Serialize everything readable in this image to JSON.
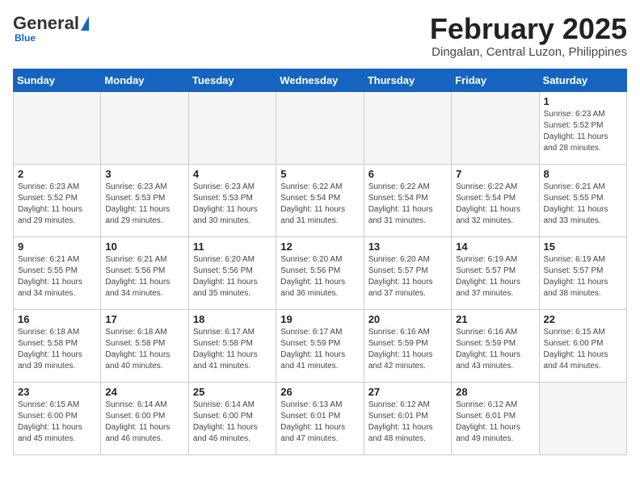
{
  "header": {
    "logo_general": "General",
    "logo_blue": "Blue",
    "title": "February 2025",
    "subtitle": "Dingalan, Central Luzon, Philippines"
  },
  "weekdays": [
    "Sunday",
    "Monday",
    "Tuesday",
    "Wednesday",
    "Thursday",
    "Friday",
    "Saturday"
  ],
  "weeks": [
    [
      {
        "day": "",
        "info": ""
      },
      {
        "day": "",
        "info": ""
      },
      {
        "day": "",
        "info": ""
      },
      {
        "day": "",
        "info": ""
      },
      {
        "day": "",
        "info": ""
      },
      {
        "day": "",
        "info": ""
      },
      {
        "day": "1",
        "info": "Sunrise: 6:23 AM\nSunset: 5:52 PM\nDaylight: 11 hours and 28 minutes."
      }
    ],
    [
      {
        "day": "2",
        "info": "Sunrise: 6:23 AM\nSunset: 5:52 PM\nDaylight: 11 hours and 29 minutes."
      },
      {
        "day": "3",
        "info": "Sunrise: 6:23 AM\nSunset: 5:53 PM\nDaylight: 11 hours and 29 minutes."
      },
      {
        "day": "4",
        "info": "Sunrise: 6:23 AM\nSunset: 5:53 PM\nDaylight: 11 hours and 30 minutes."
      },
      {
        "day": "5",
        "info": "Sunrise: 6:22 AM\nSunset: 5:54 PM\nDaylight: 11 hours and 31 minutes."
      },
      {
        "day": "6",
        "info": "Sunrise: 6:22 AM\nSunset: 5:54 PM\nDaylight: 11 hours and 31 minutes."
      },
      {
        "day": "7",
        "info": "Sunrise: 6:22 AM\nSunset: 5:54 PM\nDaylight: 11 hours and 32 minutes."
      },
      {
        "day": "8",
        "info": "Sunrise: 6:21 AM\nSunset: 5:55 PM\nDaylight: 11 hours and 33 minutes."
      }
    ],
    [
      {
        "day": "9",
        "info": "Sunrise: 6:21 AM\nSunset: 5:55 PM\nDaylight: 11 hours and 34 minutes."
      },
      {
        "day": "10",
        "info": "Sunrise: 6:21 AM\nSunset: 5:56 PM\nDaylight: 11 hours and 34 minutes."
      },
      {
        "day": "11",
        "info": "Sunrise: 6:20 AM\nSunset: 5:56 PM\nDaylight: 11 hours and 35 minutes."
      },
      {
        "day": "12",
        "info": "Sunrise: 6:20 AM\nSunset: 5:56 PM\nDaylight: 11 hours and 36 minutes."
      },
      {
        "day": "13",
        "info": "Sunrise: 6:20 AM\nSunset: 5:57 PM\nDaylight: 11 hours and 37 minutes."
      },
      {
        "day": "14",
        "info": "Sunrise: 6:19 AM\nSunset: 5:57 PM\nDaylight: 11 hours and 37 minutes."
      },
      {
        "day": "15",
        "info": "Sunrise: 6:19 AM\nSunset: 5:57 PM\nDaylight: 11 hours and 38 minutes."
      }
    ],
    [
      {
        "day": "16",
        "info": "Sunrise: 6:18 AM\nSunset: 5:58 PM\nDaylight: 11 hours and 39 minutes."
      },
      {
        "day": "17",
        "info": "Sunrise: 6:18 AM\nSunset: 5:58 PM\nDaylight: 11 hours and 40 minutes."
      },
      {
        "day": "18",
        "info": "Sunrise: 6:17 AM\nSunset: 5:58 PM\nDaylight: 11 hours and 41 minutes."
      },
      {
        "day": "19",
        "info": "Sunrise: 6:17 AM\nSunset: 5:59 PM\nDaylight: 11 hours and 41 minutes."
      },
      {
        "day": "20",
        "info": "Sunrise: 6:16 AM\nSunset: 5:59 PM\nDaylight: 11 hours and 42 minutes."
      },
      {
        "day": "21",
        "info": "Sunrise: 6:16 AM\nSunset: 5:59 PM\nDaylight: 11 hours and 43 minutes."
      },
      {
        "day": "22",
        "info": "Sunrise: 6:15 AM\nSunset: 6:00 PM\nDaylight: 11 hours and 44 minutes."
      }
    ],
    [
      {
        "day": "23",
        "info": "Sunrise: 6:15 AM\nSunset: 6:00 PM\nDaylight: 11 hours and 45 minutes."
      },
      {
        "day": "24",
        "info": "Sunrise: 6:14 AM\nSunset: 6:00 PM\nDaylight: 11 hours and 46 minutes."
      },
      {
        "day": "25",
        "info": "Sunrise: 6:14 AM\nSunset: 6:00 PM\nDaylight: 11 hours and 46 minutes."
      },
      {
        "day": "26",
        "info": "Sunrise: 6:13 AM\nSunset: 6:01 PM\nDaylight: 11 hours and 47 minutes."
      },
      {
        "day": "27",
        "info": "Sunrise: 6:12 AM\nSunset: 6:01 PM\nDaylight: 11 hours and 48 minutes."
      },
      {
        "day": "28",
        "info": "Sunrise: 6:12 AM\nSunset: 6:01 PM\nDaylight: 11 hours and 49 minutes."
      },
      {
        "day": "",
        "info": ""
      }
    ]
  ]
}
